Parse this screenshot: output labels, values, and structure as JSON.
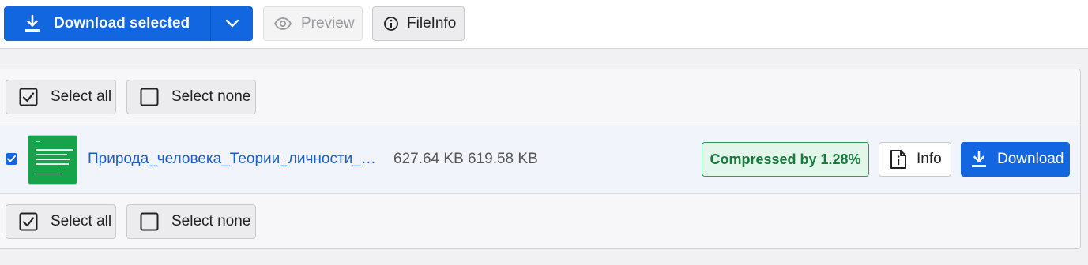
{
  "toolbar": {
    "download_selected_label": "Download selected",
    "preview_label": "Preview",
    "fileinfo_label": "FileInfo"
  },
  "selection": {
    "select_all_label": "Select all",
    "select_none_label": "Select none"
  },
  "file": {
    "name": "Природа_человека_Теории_личности_со…",
    "original_size": "627.64 KB",
    "new_size": "619.58 KB",
    "compression_label": "Compressed by 1.28%",
    "info_label": "Info",
    "download_label": "Download",
    "checked": true
  },
  "colors": {
    "primary": "#1266e0",
    "success_text": "#157a3c",
    "success_bg": "#e3f6ea",
    "link": "#1a5fc9"
  },
  "icons": {
    "download": "download-icon",
    "chevron": "chevron-down-icon",
    "preview": "eye-icon",
    "fileinfo": "info-circle-icon",
    "checkbox_checked": "checkbox-checked-icon",
    "checkbox_empty": "checkbox-empty-icon",
    "file_info": "file-info-icon"
  }
}
